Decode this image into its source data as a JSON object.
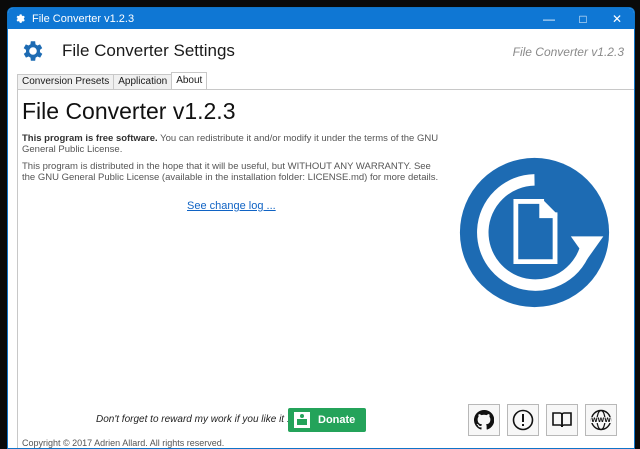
{
  "window": {
    "title": "File Converter v1.2.3",
    "controls": [
      "minimize",
      "maximize",
      "close"
    ]
  },
  "header": {
    "title": "File Converter Settings",
    "version": "File Converter v1.2.3"
  },
  "tabs": [
    {
      "label": "Conversion Presets",
      "active": false
    },
    {
      "label": "Application",
      "active": false
    },
    {
      "label": "About",
      "active": true
    }
  ],
  "about": {
    "title": "File Converter v1.2.3",
    "free_software_bold": "This program is free software.",
    "free_software_text": " You can redistribute it and/or modify it under the terms of the GNU General Public License.",
    "warranty_text": "This program is distributed in the hope that it will be useful, but WITHOUT ANY WARRANTY. See the GNU General Public License (available in the installation folder: LICENSE.md) for more details.",
    "changelog_link": "See change log ...",
    "reward_text": "Don't forget to reward my work if you like it :)",
    "donate_label": "Donate",
    "copyright": "Copyright © 2017 Adrien Allard. All rights reserved."
  },
  "icons": {
    "app": "gear-icon",
    "logo": "file-refresh-logo",
    "links": [
      "github-icon",
      "exclamation-icon",
      "book-icon",
      "www-icon"
    ]
  },
  "colors": {
    "titlebar": "#0f77d4",
    "accent": "#1d6bb3",
    "donate": "#24a35a",
    "link": "#1063c4"
  }
}
